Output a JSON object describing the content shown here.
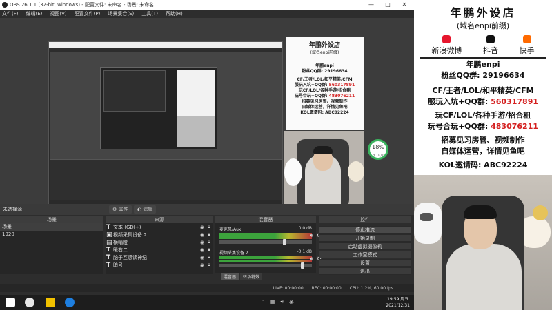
{
  "window": {
    "title": "OBS 26.1.1 (32-bit, windows) - 配置文件: 未命名 - 场景: 未命名"
  },
  "menu": [
    "文件(F)",
    "编辑(E)",
    "视图(V)",
    "配置文件(P)",
    "场景集合(S)",
    "工具(T)",
    "帮助(H)"
  ],
  "scene_bar": {
    "label": "未选择源",
    "properties": "属性",
    "filters": "滤镜"
  },
  "docks": {
    "scenes": {
      "title": "场景",
      "items": [
        "场景",
        "1920"
      ]
    },
    "sources": {
      "title": "来源",
      "items": [
        "文本 (GDI+)",
        "视频采集设备 2",
        "横幅瞪",
        "暖右二",
        "脑子互感读神纪",
        "暗号"
      ]
    },
    "mixer": {
      "title": "混音器",
      "channels": [
        {
          "name": "麦克风/Aux",
          "level": "0.0 dB"
        },
        {
          "name": "视频采集设备 2",
          "level": "-0.1 dB"
        }
      ],
      "tabs": [
        "混音器",
        "转场特效"
      ]
    },
    "controls": {
      "title": "控件",
      "buttons": [
        "停止推流",
        "开始录制",
        "启动虚拟摄像机",
        "工作室模式",
        "设置",
        "退出"
      ]
    }
  },
  "status": {
    "live": "LIVE: 00:00:00",
    "rec": "REC: 00:00:00",
    "cpu": "CPU: 1.2%, 60.00 fps"
  },
  "taskbar": {
    "time": "19:59 周五",
    "date": "2021/12/31",
    "ime": "英"
  },
  "cpu_widget": {
    "percent": "18%",
    "speed": "3.1K/s"
  },
  "ad": {
    "title": "年鹏外设店",
    "subtitle": "(域名enpi前缀)",
    "socials": [
      "新浪微博",
      "抖音",
      "快手"
    ],
    "brand": "年鹏enpi",
    "qq": "粉丝QQ群: 29196634",
    "line1": "CF/王者/LOL/和平精英/CFM",
    "line2_a": "服玩入坑+QQ群: ",
    "line2_b": "560317891",
    "line3": "玩CF/LOL/各种手游/招合租",
    "line4_a": "玩号合玩+QQ群: ",
    "line4_b": "483076211",
    "line5": "招募见习房管、视频制作",
    "line6": "自媒体运营，详情见鱼吧",
    "line7": "KOL邀请码: ABC92224"
  },
  "colors": {
    "accent_red": "#d42020",
    "meter_green": "#3ca33c"
  }
}
